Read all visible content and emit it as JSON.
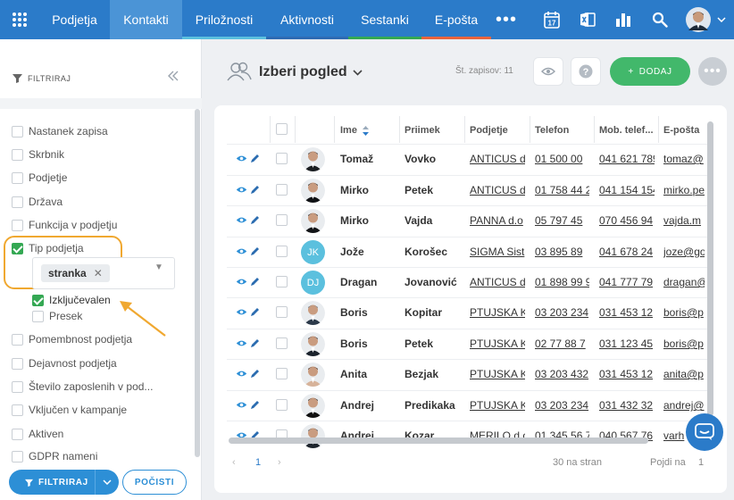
{
  "nav": {
    "tabs": [
      {
        "label": "Podjetja"
      },
      {
        "label": "Kontakti"
      },
      {
        "label": "Priložnosti"
      },
      {
        "label": "Aktivnosti"
      },
      {
        "label": "Sestanki"
      },
      {
        "label": "E-pošta"
      }
    ],
    "active_tab": "Kontakti",
    "calendar_day": "17",
    "icons": [
      "apps-grid-icon",
      "more-dots-icon",
      "calendar-icon",
      "excel-icon",
      "chart-icon",
      "search-icon",
      "avatar",
      "chevron-down-icon"
    ]
  },
  "sidebar": {
    "header": "FILTRIRAJ",
    "filters": [
      {
        "label": "Nastanek zapisa",
        "checked": false
      },
      {
        "label": "Skrbnik",
        "checked": false
      },
      {
        "label": "Podjetje",
        "checked": false
      },
      {
        "label": "Država",
        "checked": false
      },
      {
        "label": "Funkcija v podjetju",
        "checked": false
      },
      {
        "label": "Tip podjetja",
        "checked": true
      },
      {
        "label": "Izključevalen",
        "checked": true
      },
      {
        "label": "Presek",
        "checked": false
      },
      {
        "label": "Pomembnost podjetja",
        "checked": false
      },
      {
        "label": "Dejavnost podjetja",
        "checked": false
      },
      {
        "label": "Število zaposlenih v pod...",
        "checked": false
      },
      {
        "label": "Vključen v kampanje",
        "checked": false
      },
      {
        "label": "Aktiven",
        "checked": false
      },
      {
        "label": "GDPR nameni",
        "checked": false
      }
    ],
    "chip": "stranka",
    "filter_button": "FILTRIRAJ",
    "reset_button": "POČISTI"
  },
  "main": {
    "view_title": "Izberi pogled",
    "record_count": "Št. zapisov: 11",
    "add_button": "DODAJ",
    "columns": [
      "Ime",
      "Priimek",
      "Podjetje",
      "Telefon",
      "Mob. telef...",
      "E-pošta"
    ],
    "rows": [
      {
        "first": "Tomaž",
        "last": "Vovko",
        "company": "ANTICUS d",
        "phone": "01 500 00",
        "mobile": "041 621 789",
        "email": "tomaz@",
        "initials": ""
      },
      {
        "first": "Mirko",
        "last": "Petek",
        "company": "ANTICUS d",
        "phone": "01 758 44 2",
        "mobile": "041 154 154",
        "email": "mirko.pe",
        "initials": ""
      },
      {
        "first": "Mirko",
        "last": "Vajda",
        "company": "PANNA d.o",
        "phone": "05 797 45",
        "mobile": "070 456 94",
        "email": "vajda.m",
        "initials": ""
      },
      {
        "first": "Jože",
        "last": "Korošec",
        "company": "SIGMA Sist",
        "phone": "03 895 89",
        "mobile": "041 678 24",
        "email": "joze@go",
        "initials": "JK"
      },
      {
        "first": "Dragan",
        "last": "Jovanović",
        "company": "ANTICUS d",
        "phone": "01 898 99 9",
        "mobile": "041 777 79",
        "email": "dragan@",
        "initials": "DJ"
      },
      {
        "first": "Boris",
        "last": "Kopitar",
        "company": "PTUJSKA K",
        "phone": "03 203 234",
        "mobile": "031 453 12",
        "email": "boris@p",
        "initials": ""
      },
      {
        "first": "Boris",
        "last": "Petek",
        "company": "PTUJSKA K",
        "phone": "02 77 88 7",
        "mobile": "031 123 45",
        "email": "boris@p",
        "initials": ""
      },
      {
        "first": "Anita",
        "last": "Bezjak",
        "company": "PTUJSKA K",
        "phone": "03 203 432",
        "mobile": "031 453 12",
        "email": "anita@p",
        "initials": ""
      },
      {
        "first": "Andrej",
        "last": "Predikaka",
        "company": "PTUJSKA K",
        "phone": "03 203 234",
        "mobile": "031 432 32",
        "email": "andrej@",
        "initials": ""
      },
      {
        "first": "Andrej",
        "last": "Kozar",
        "company": "MERILO d.o",
        "phone": "01 345 56 7",
        "mobile": "040 567 76",
        "email": "varh",
        "initials": ""
      }
    ],
    "pager": {
      "page": "1",
      "per_page": "30 na stran",
      "goto_label": "Pojdi na",
      "goto_value": "1"
    }
  },
  "colors": {
    "nav_bg": "#2b7bc9",
    "nav_active": "#4b94d6",
    "accent_green": "#42b86b",
    "highlight": "#f0a830",
    "checkbox_on": "#34a853"
  }
}
